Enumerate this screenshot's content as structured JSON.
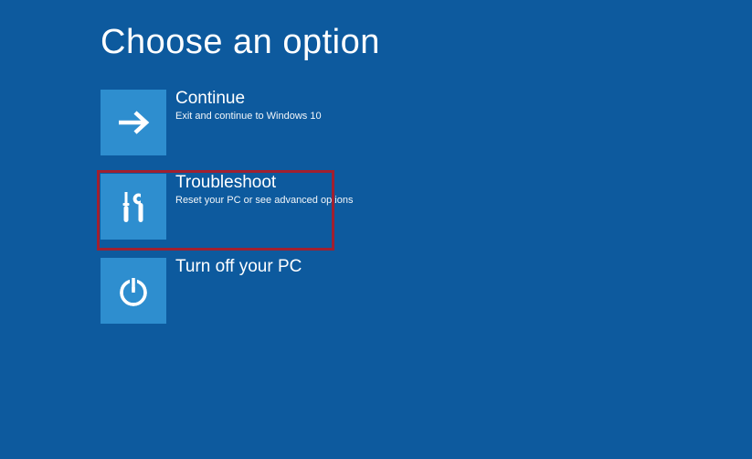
{
  "page_title": "Choose an option",
  "options": [
    {
      "title": "Continue",
      "desc": "Exit and continue to Windows 10"
    },
    {
      "title": "Troubleshoot",
      "desc": "Reset your PC or see advanced options"
    },
    {
      "title": "Turn off your PC",
      "desc": ""
    }
  ],
  "highlight_color": "#a02030",
  "tile_color": "#2e8ecf",
  "background_color": "#0d5a9e"
}
